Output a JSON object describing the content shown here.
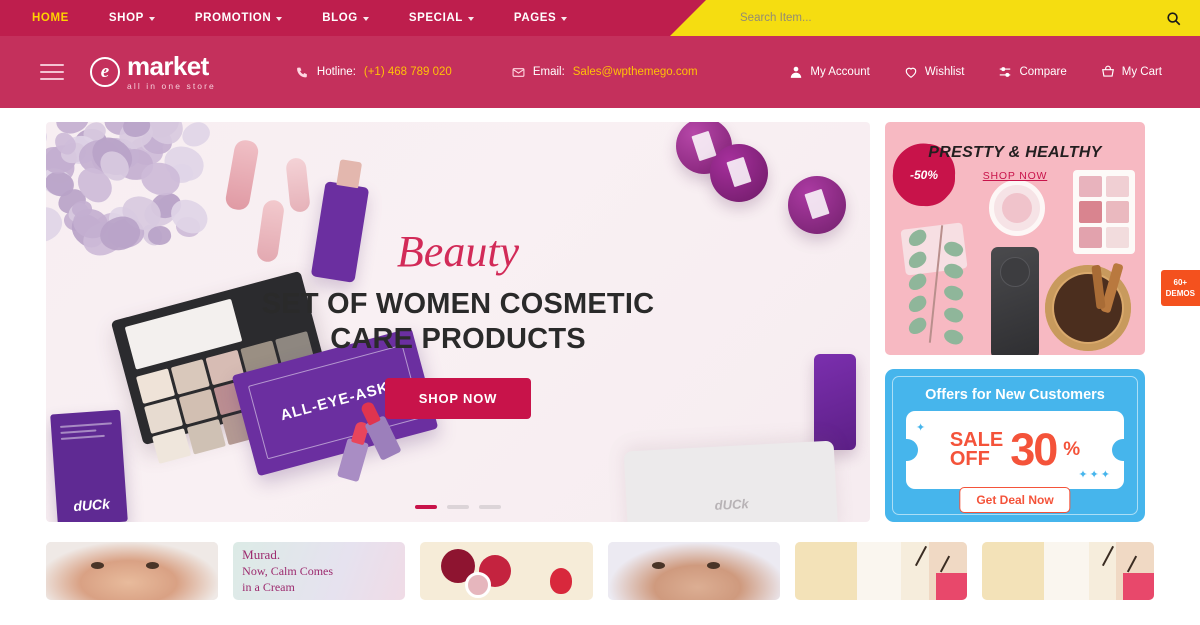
{
  "topnav": {
    "items": [
      {
        "label": "HOME",
        "active": true,
        "caret": false
      },
      {
        "label": "SHOP",
        "active": false,
        "caret": true
      },
      {
        "label": "PROMOTION",
        "active": false,
        "caret": true
      },
      {
        "label": "BLOG",
        "active": false,
        "caret": true
      },
      {
        "label": "SPECIAL",
        "active": false,
        "caret": true
      },
      {
        "label": "PAGES",
        "active": false,
        "caret": true
      }
    ]
  },
  "search": {
    "placeholder": "Search Item...",
    "value": "",
    "icon": "search-icon"
  },
  "header": {
    "menu_icon": "hamburger-icon",
    "logo": {
      "mark": "e",
      "name": "market",
      "tagline": "all in one store"
    },
    "hotline": {
      "icon": "phone-icon",
      "label": "Hotline:",
      "value": "(+1) 468 789 020"
    },
    "email": {
      "icon": "mail-icon",
      "label": "Email:",
      "value": "Sales@wpthemego.com"
    },
    "actions": [
      {
        "label": "My Account",
        "icon": "user-icon"
      },
      {
        "label": "Wishlist",
        "icon": "heart-icon"
      },
      {
        "label": "Compare",
        "icon": "compare-icon"
      },
      {
        "label": "My Cart",
        "icon": "cart-icon"
      }
    ]
  },
  "slider": {
    "script_text": "Beauty",
    "headline_line1": "SET OF WOMEN COSMETIC",
    "headline_line2": "CARE PRODUCTS",
    "cta": "SHOP NOW",
    "palette_text": "ALL-EYE-ASK",
    "duck_brand": "dUCk",
    "bag_brand": "dUCk",
    "dots": [
      {
        "active": true
      },
      {
        "active": false
      },
      {
        "active": false
      }
    ]
  },
  "promo_pink": {
    "badge": "-50%",
    "title": "PRESTTY & HEALTHY",
    "link": "SHOP NOW"
  },
  "promo_blue": {
    "header": "Offers for New Customers",
    "sale_line1": "SALE",
    "sale_line2": "OFF",
    "amount": "30",
    "percent": "%",
    "cta": "Get Deal Now"
  },
  "demos_tab": {
    "line1": "60+",
    "line2": "DEMOS"
  },
  "strip": {
    "tiles": [
      {
        "kind": "face",
        "bg": "#e8e6e6"
      },
      {
        "kind": "text",
        "bg": "#d9e9e6",
        "brand": "Murad.",
        "line1": "Now, Calm Comes",
        "line2": "in a Cream"
      },
      {
        "kind": "berry",
        "bg": "#f6ecd8"
      },
      {
        "kind": "face2",
        "bg": "#eceaf2"
      },
      {
        "kind": "room",
        "bg": "#f6eddc"
      },
      {
        "kind": "room",
        "bg": "#f6eddc"
      }
    ]
  },
  "colors": {
    "topbar": "#be1e4d",
    "header": "#c4305c",
    "search_bg": "#f5dd11",
    "accent": "#c8134a",
    "gold": "#ffc107",
    "blue": "#46b5ec",
    "orange": "#f4533a",
    "pink": "#f7b9c2"
  }
}
